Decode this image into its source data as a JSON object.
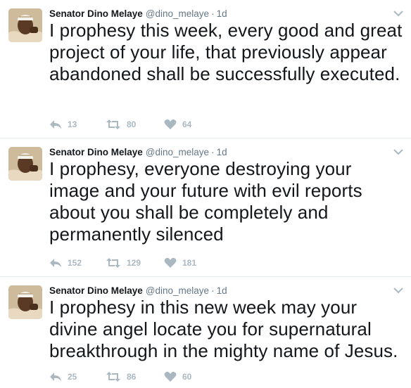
{
  "tweets": [
    {
      "name": "Senator Dino Melaye",
      "handle": "@dino_melaye",
      "separator": "·",
      "time": "1d",
      "text": "I prophesy this week, every good and great project of your life, that previously appear abandoned shall be successfully executed.",
      "replies": "13",
      "retweets": "80",
      "likes": "64"
    },
    {
      "name": "Senator Dino Melaye",
      "handle": "@dino_melaye",
      "separator": "·",
      "time": "1d",
      "text": "I prophesy, everyone destroying your image and your future with evil reports about you shall be completely and permanently silenced",
      "replies": "152",
      "retweets": "129",
      "likes": "181"
    },
    {
      "name": "Senator Dino Melaye",
      "handle": "@dino_melaye",
      "separator": "·",
      "time": "1d",
      "text": "I prophesy in this new week may your divine angel locate you for supernatural breakthrough in the mighty name of Jesus.",
      "replies": "25",
      "retweets": "86",
      "likes": "60"
    }
  ],
  "icons": {
    "reply": "reply-icon",
    "retweet": "retweet-icon",
    "like": "heart-icon",
    "more": "chevron-down-icon"
  },
  "colors": {
    "icon_gray": "#aab8c2",
    "secondary_text": "#657786",
    "divider": "#e6ecf0"
  }
}
